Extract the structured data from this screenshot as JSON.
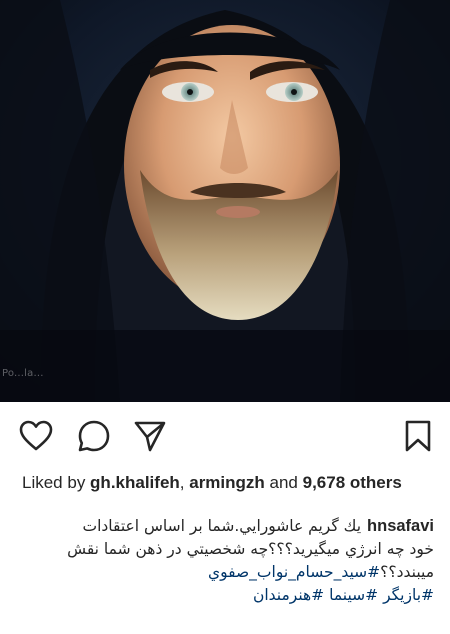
{
  "post": {
    "image": {
      "description_icon": "portrait-photo",
      "watermark": "Po...la..."
    },
    "actions": {
      "like_icon": "heart-outline-icon",
      "comment_icon": "comment-bubble-icon",
      "share_icon": "paper-plane-icon",
      "save_icon": "bookmark-outline-icon"
    },
    "likes": {
      "prefix": "Liked by ",
      "user1": "gh.khalifeh",
      "separator": ", ",
      "user2": "armingzh",
      "middle": " and ",
      "count": "9,678",
      "suffix": " others"
    },
    "caption": {
      "username": "hnsafavi",
      "line1": "يك گريم عاشورايي.شما بر اساس اعتقادات",
      "line2": "خود چه انرژي ميگيريد؟؟؟چه شخصيتي در ذهن شما نقش",
      "line3_text": "ميبندد؟؟",
      "line3_tag": "#سيد_حسام_نواب_صفوي",
      "tag1": "#بازيگر",
      "tag2": "#سينما",
      "tag3": "#هنرمندان"
    }
  },
  "colors": {
    "text": "#262626",
    "hashtag": "#003569",
    "photo_bg": "#0d1420"
  }
}
